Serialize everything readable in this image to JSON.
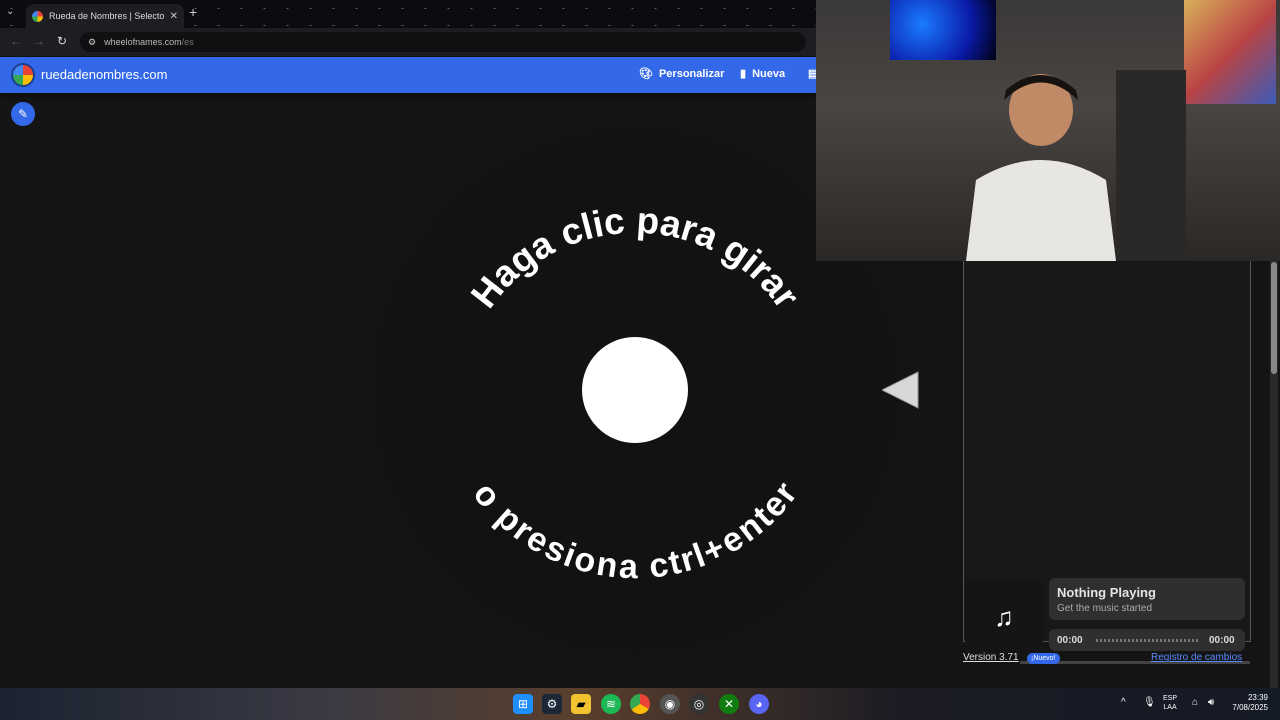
{
  "browser": {
    "tab_title": "Rueda de Nombres | Selector...",
    "url_domain": "wheelofnames.com",
    "url_path": "/es"
  },
  "site": {
    "name": "ruedadenombres.com",
    "nav": {
      "customize": "Personalizar",
      "new": "Nueva"
    }
  },
  "wheel": {
    "top_text": "Haga clic para girar",
    "bottom_text": "o presiona ctrl+enter"
  },
  "player": {
    "title": "Nothing Playing",
    "subtitle": "Get the music started",
    "time_current": "00:00",
    "time_total": "00:00"
  },
  "footer": {
    "version": "Version 3.71",
    "badge": "¡Nuevo!",
    "changelog": "Registro de cambios"
  },
  "taskbar": {
    "lang_top": "ESP",
    "lang_bottom": "LAA",
    "time": "23:39",
    "date": "7/08/2025"
  },
  "colors": {
    "brand_blue": "#3369e8",
    "background": "#141414"
  }
}
